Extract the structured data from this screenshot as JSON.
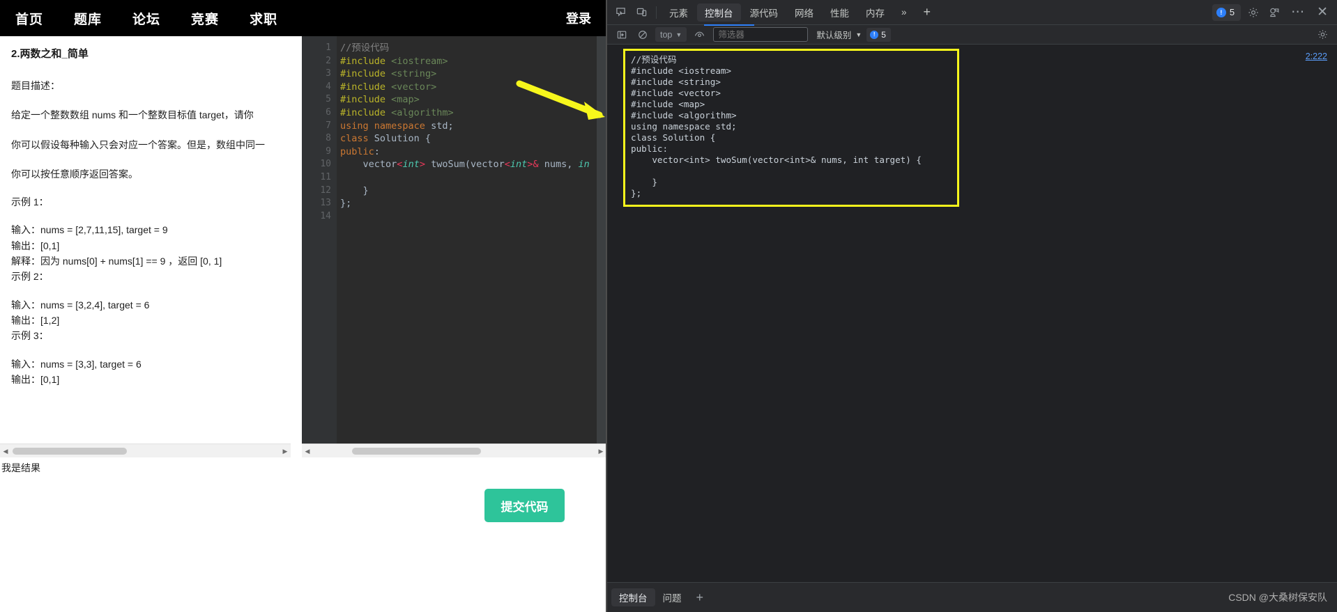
{
  "site": {
    "nav": [
      {
        "label": "首页"
      },
      {
        "label": "题库"
      },
      {
        "label": "论坛"
      },
      {
        "label": "竞赛"
      },
      {
        "label": "求职"
      }
    ],
    "login_label": "登录"
  },
  "problem": {
    "title": "2.两数之和_简单",
    "desc_label": "题目描述：",
    "para1": "给定一个整数数组 nums 和一个整数目标值 target，请你",
    "para2": "你可以假设每种输入只会对应一个答案。但是，数组中同一",
    "para3": "你可以按任意顺序返回答案。",
    "example1_label": "示例 1：",
    "example1_input": "输入：nums = [2,7,11,15], target = 9",
    "example1_output": "输出：[0,1]",
    "example1_explain": "解释：因为 nums[0] + nums[1] == 9 ，返回 [0, 1]",
    "example2_label": "示例 2：",
    "example2_input": "输入：nums = [3,2,4], target = 6",
    "example2_output": "输出：[1,2]",
    "example3_label": "示例 3：",
    "example3_input": "输入：nums = [3,3], target = 6",
    "example3_output": "输出：[0,1]",
    "result_text": "我是结果"
  },
  "editor": {
    "line_numbers": [
      "1",
      "2",
      "3",
      "4",
      "5",
      "6",
      "7",
      "8",
      "9",
      "10",
      "11",
      "12",
      "13",
      "14"
    ],
    "submit_label": "提交代码"
  },
  "devtools": {
    "tabs": [
      {
        "label": "元素",
        "active": false
      },
      {
        "label": "控制台",
        "active": true
      },
      {
        "label": "源代码",
        "active": false
      },
      {
        "label": "网络",
        "active": false
      },
      {
        "label": "性能",
        "active": false
      },
      {
        "label": "内存",
        "active": false
      }
    ],
    "overflow_label": "»",
    "add_tab_label": "+",
    "issues_count": "5",
    "close_label": "✕",
    "more_label": "⋯",
    "console": {
      "context_value": "top",
      "filter_placeholder": "筛选器",
      "level_value": "默认级别",
      "issues_count": "5",
      "source_link": "2:222",
      "output_lines": [
        "//预设代码",
        "#include <iostream>",
        "#include <string>",
        "#include <vector>",
        "#include <map>",
        "#include <algorithm>",
        "using namespace std;",
        "class Solution {",
        "public:",
        "    vector<int> twoSum(vector<int>& nums, int target) {",
        "",
        "    }",
        "};"
      ]
    },
    "drawer": {
      "tabs": [
        {
          "label": "控制台",
          "active": true
        },
        {
          "label": "问题",
          "active": false
        }
      ],
      "add_label": "+"
    },
    "watermark": "CSDN @大桑树保安队"
  }
}
